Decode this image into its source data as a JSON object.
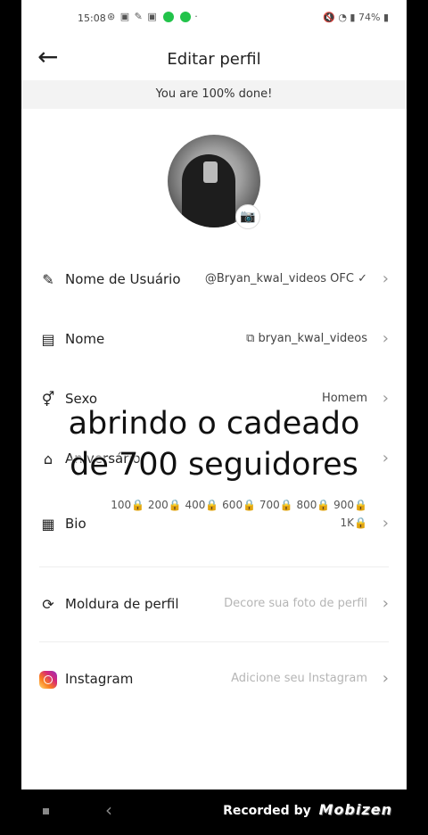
{
  "status_bar": {
    "time": "15:08",
    "battery": "74%"
  },
  "header": {
    "title": "Editar perfil"
  },
  "progress_text": "You are 100% done!",
  "rows": {
    "username": {
      "label": "Nome de Usuário",
      "value": "@Bryan_kwal_videos OFC ✓"
    },
    "name": {
      "label": "Nome",
      "value": "⧉ bryan_kwal_videos"
    },
    "sex": {
      "label": "Sexo",
      "value": "Homem"
    },
    "birthday": {
      "label": "Aniversário",
      "value": ""
    },
    "bio": {
      "label": "Bio",
      "value": "100🔒 200🔒 400🔒 600🔒 700🔒 800🔒 900🔒 1K🔒"
    },
    "frame": {
      "label": "Moldura de perfil",
      "value": "Decore sua foto de perfil"
    },
    "instagram": {
      "label": "Instagram",
      "value": "Adicione seu Instagram"
    }
  },
  "overlay": {
    "line1": "abrindo o cadeado",
    "line2": "de 700 seguidores"
  },
  "recorder": {
    "prefix": "Recorded by",
    "brand": "Mobizen"
  },
  "colors": {
    "background": "#ffffff",
    "overlay_text": "#111111",
    "placeholder": "#b5b5b5"
  }
}
